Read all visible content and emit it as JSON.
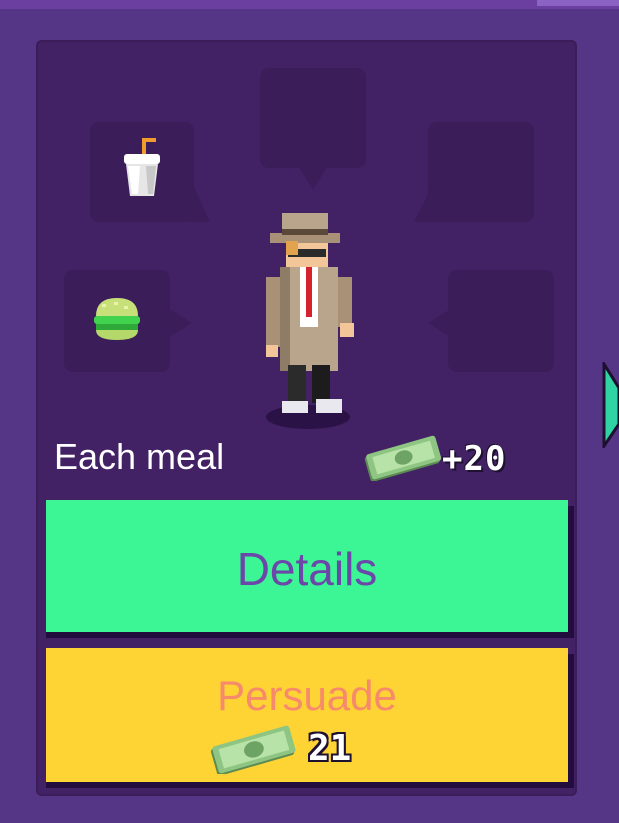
{
  "reward": {
    "label": "Each meal",
    "value": "+20",
    "icon": "cash-icon"
  },
  "actions": {
    "details_label": "Details",
    "persuade_label": "Persuade",
    "persuade_cost": "21",
    "cost_icon": "cash-icon"
  },
  "slots": [
    {
      "position": "top-left",
      "item": "drink-cup-icon"
    },
    {
      "position": "top",
      "item": null
    },
    {
      "position": "top-right",
      "item": null
    },
    {
      "position": "left",
      "item": "green-burger-icon"
    },
    {
      "position": "right",
      "item": null
    }
  ],
  "character": "detective-customer",
  "colors": {
    "background": "#553585",
    "card": "#422264",
    "bubble": "#3b1d5a",
    "details_button": "#3cf594",
    "details_text": "#6c46a8",
    "persuade_button": "#fed435",
    "persuade_text": "#f68a6a",
    "arrow": "#2fd3a4"
  }
}
